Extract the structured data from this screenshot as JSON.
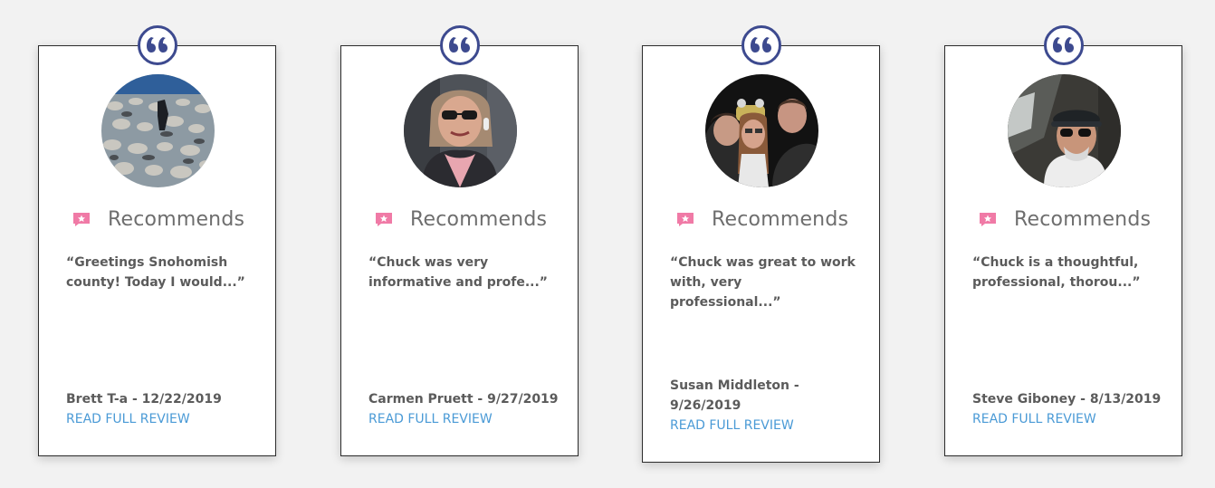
{
  "recommends_label": "Recommends",
  "read_more_label": "READ FULL REVIEW",
  "colors": {
    "badge_ring": "#3d4a8f",
    "recommend_icon": "#f07aa6",
    "link": "#4a9ad6",
    "text": "#5b5b5b"
  },
  "reviews": [
    {
      "quote": "“Greetings Snohomish county! Today I would...”",
      "name": "Brett T-a",
      "date": "12/22/2019"
    },
    {
      "quote": "“Chuck was very informative and profe...”",
      "name": "Carmen Pruett",
      "date": "9/27/2019"
    },
    {
      "quote": "“Chuck was great to work with, very professional...”",
      "name": "Susan Middleton",
      "date": "9/26/2019"
    },
    {
      "quote": "“Chuck is a thoughtful, professional, thorou...”",
      "name": "Steve Giboney",
      "date": "8/13/2019"
    }
  ]
}
